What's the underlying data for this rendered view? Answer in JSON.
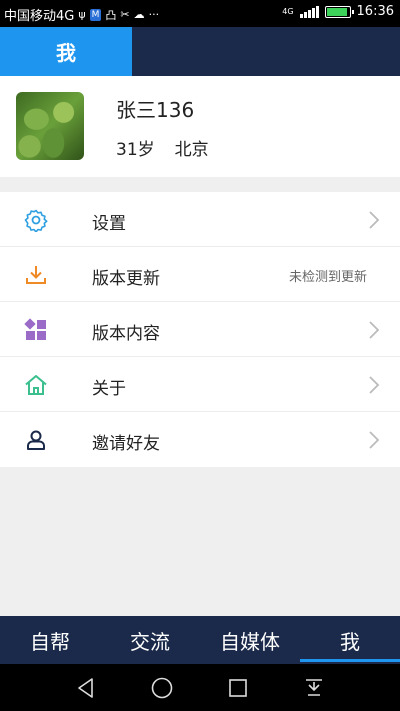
{
  "status_bar": {
    "carrier": "中国移动4G",
    "network": "4G",
    "battery_level": 0.85,
    "time": "16:36",
    "icons": [
      "usb-icon",
      "m-app-icon",
      "notification-icon",
      "scissors-icon",
      "wechat-icon",
      "more-icon"
    ]
  },
  "top_bar": {
    "active_tab": "我"
  },
  "profile": {
    "name": "张三136",
    "age": "31岁",
    "city": "北京"
  },
  "menu": {
    "items": [
      {
        "label": "设置",
        "icon": "gear-icon"
      },
      {
        "label": "版本更新",
        "icon": "download-icon",
        "status": "未检测到更新"
      },
      {
        "label": "版本内容",
        "icon": "grid-icon"
      },
      {
        "label": "关于",
        "icon": "home-icon"
      },
      {
        "label": "邀请好友",
        "icon": "person-icon"
      }
    ]
  },
  "bottom_nav": {
    "items": [
      "自帮",
      "交流",
      "自媒体",
      "我"
    ],
    "active": "我"
  },
  "colors": {
    "accent": "#1e96f0",
    "navbar": "#1b2a4a",
    "gear_icon": "#2e9fe0",
    "download_icon": "#f08a24",
    "grid_icon": "#9b6bc8",
    "home_icon": "#3bbf8e",
    "person_icon": "#1b2a4a"
  }
}
